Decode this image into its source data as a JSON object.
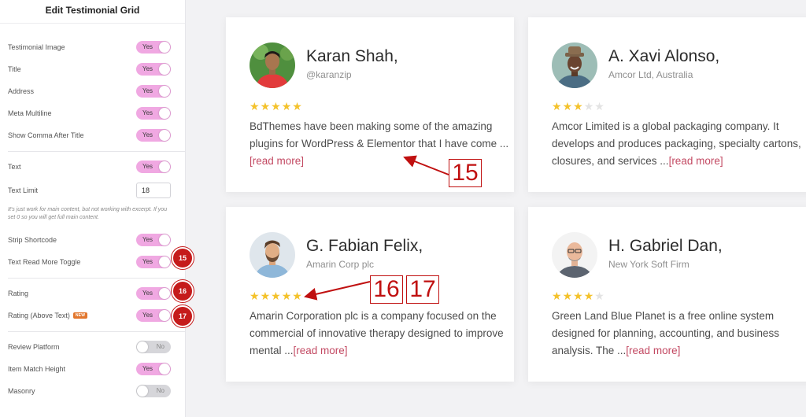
{
  "panel": {
    "title": "Edit Testimonial Grid",
    "controls": [
      {
        "label": "Testimonial Image",
        "value": "Yes"
      },
      {
        "label": "Title",
        "value": "Yes"
      },
      {
        "label": "Address",
        "value": "Yes"
      },
      {
        "label": "Meta Multiline",
        "value": "Yes"
      },
      {
        "label": "Show Comma After Title",
        "value": "Yes"
      },
      {
        "label": "Text",
        "value": "Yes"
      },
      {
        "label": "Text Limit",
        "value": "18"
      },
      {
        "label": "Strip Shortcode",
        "value": "Yes"
      },
      {
        "label": "Text Read More Toggle",
        "value": "Yes"
      },
      {
        "label": "Rating",
        "value": "Yes"
      },
      {
        "label": "Rating (Above Text)",
        "value": "Yes",
        "badge": "NEW"
      },
      {
        "label": "Review Platform",
        "value": "No"
      },
      {
        "label": "Item Match Height",
        "value": "Yes"
      },
      {
        "label": "Masonry",
        "value": "No"
      }
    ],
    "help_text": "It's just work for main content, but not working with excerpt. If you set 0 so you will get full main content."
  },
  "markers": [
    "15",
    "16",
    "17"
  ],
  "testimonials": [
    {
      "name": "Karan Shah,",
      "subtitle": "@karanzip",
      "rating": 5,
      "text": "BdThemes have been making some of the amazing plugins for WordPress & Elementor that I have come ...",
      "read_more": "[read more]"
    },
    {
      "name": "A. Xavi Alonso,",
      "subtitle": "Amcor Ltd, Australia",
      "rating": 3,
      "text": "Amcor Limited is a global packaging company. It develops and produces packaging, specialty cartons, closures, and services ...",
      "read_more": "[read more]"
    },
    {
      "name": "G. Fabian Felix,",
      "subtitle": "Amarin Corp plc",
      "rating": 5,
      "text": "Amarin Corporation plc is a company focused on the commercial of innovative therapy designed to improve mental ...",
      "read_more": "[read more]"
    },
    {
      "name": "H. Gabriel Dan,",
      "subtitle": "New York Soft Firm",
      "rating": 4,
      "text": "Green Land Blue Planet is a free online system designed for planning, accounting, and business analysis. The ...",
      "read_more": "[read more]"
    }
  ],
  "colors": {
    "toggle_on": "#f0a8e2",
    "star": "#f4c22b",
    "read_more": "#c34a63",
    "annotation": "#c01010"
  }
}
